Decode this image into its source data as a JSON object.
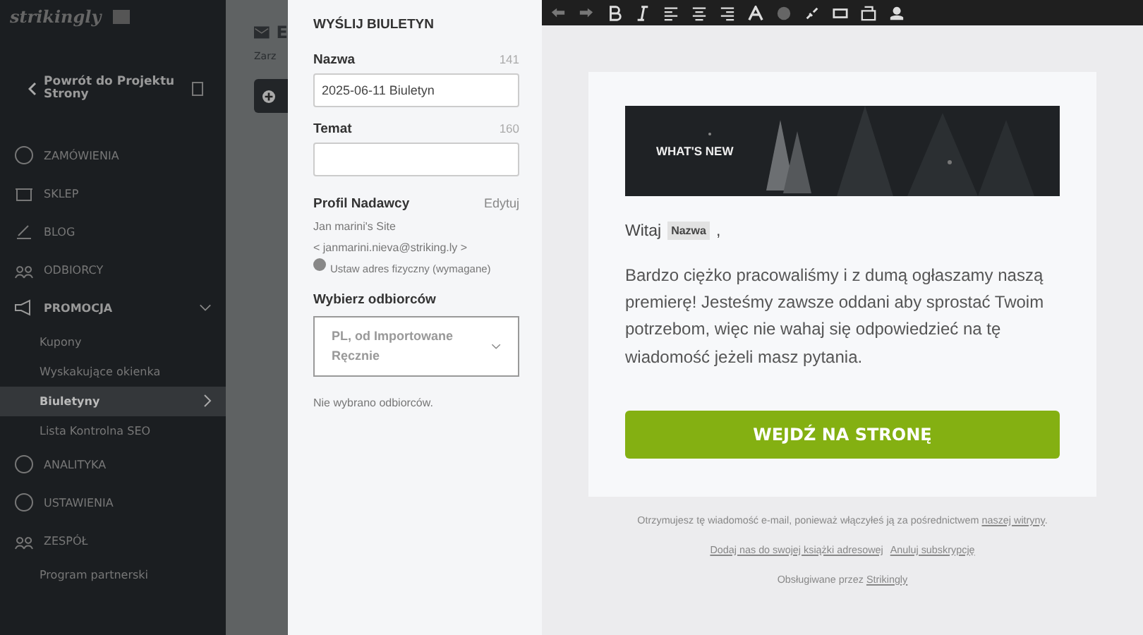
{
  "sidebar": {
    "logo": "strikingly",
    "back": "Powrót do Projektu Strony",
    "items": [
      {
        "label": "ZAMÓWIENIA",
        "kind": "section",
        "selected": false,
        "expanded": false
      },
      {
        "label": "SKLEP",
        "kind": "section",
        "selected": false,
        "expanded": false
      },
      {
        "label": "BLOG",
        "kind": "section",
        "selected": false,
        "expanded": false
      },
      {
        "label": "ODBIORCY",
        "kind": "section",
        "selected": false,
        "expanded": false
      },
      {
        "label": "PROMOCJA",
        "kind": "section",
        "selected": false,
        "expanded": true
      },
      {
        "label": "Kupony",
        "kind": "sub",
        "selected": false
      },
      {
        "label": "Wyskakujące okienka",
        "kind": "sub",
        "selected": false
      },
      {
        "label": "Biuletyny",
        "kind": "sub",
        "selected": true
      },
      {
        "label": "Lista Kontrolna SEO",
        "kind": "sub",
        "selected": false
      },
      {
        "label": "ANALITYKA",
        "kind": "section",
        "selected": false,
        "expanded": false
      },
      {
        "label": "USTAWIENIA",
        "kind": "section",
        "selected": false,
        "expanded": false
      },
      {
        "label": "ZESPÓŁ",
        "kind": "section",
        "selected": false,
        "expanded": false
      },
      {
        "label": "Program partnerski",
        "kind": "sub",
        "selected": false
      }
    ]
  },
  "behind": {
    "title": "E",
    "subtitle": "Zarz"
  },
  "panel": {
    "title": "WYŚLIJ BIULETYN",
    "name_field": {
      "label": "Nazwa",
      "count": "141",
      "value": "2025-06-11 Biuletyn"
    },
    "subject_field": {
      "label": "Temat",
      "count": "160"
    },
    "sender": {
      "label": "Profil Nadawcy",
      "edit": "Edytuj",
      "site": "Jan marini's Site",
      "email": "< janmarini.nieva@striking.ly >",
      "address": "Ustaw adres fizyczny (wymagane)"
    },
    "recipients": {
      "label": "Wybierz odbiorców",
      "value": "PL, od Importowane Ręcznie",
      "note": "Nie wybrano odbiorców."
    }
  },
  "email": {
    "banner": "WHAT'S NEW",
    "greeting": "Witaj",
    "greeting_tag": "Nazwa",
    "greeting_end": ",",
    "body": "Bardzo ciężko pracowaliśmy i z dumą ogłaszamy naszą premierę! Jesteśmy zawsze  oddani aby sprostać Twoim potrzebom, więc nie wahaj się odpowiedzieć na tę wiadomość jeżeli masz pytania.",
    "button": "WEJDŹ NA STRONĘ",
    "footer_text": "Otrzymujesz tę wiadomość e-mail, ponieważ włączyłeś ją za pośrednictwem",
    "footer_link": "naszej witryny",
    "footer_end": ".",
    "add_link": "Dodaj nas do swojej książki adresowej",
    "unsubscribe": "Anuluj subskrypcję",
    "powered": "Obsługiwane przez",
    "powered_link": "Strikingly"
  }
}
